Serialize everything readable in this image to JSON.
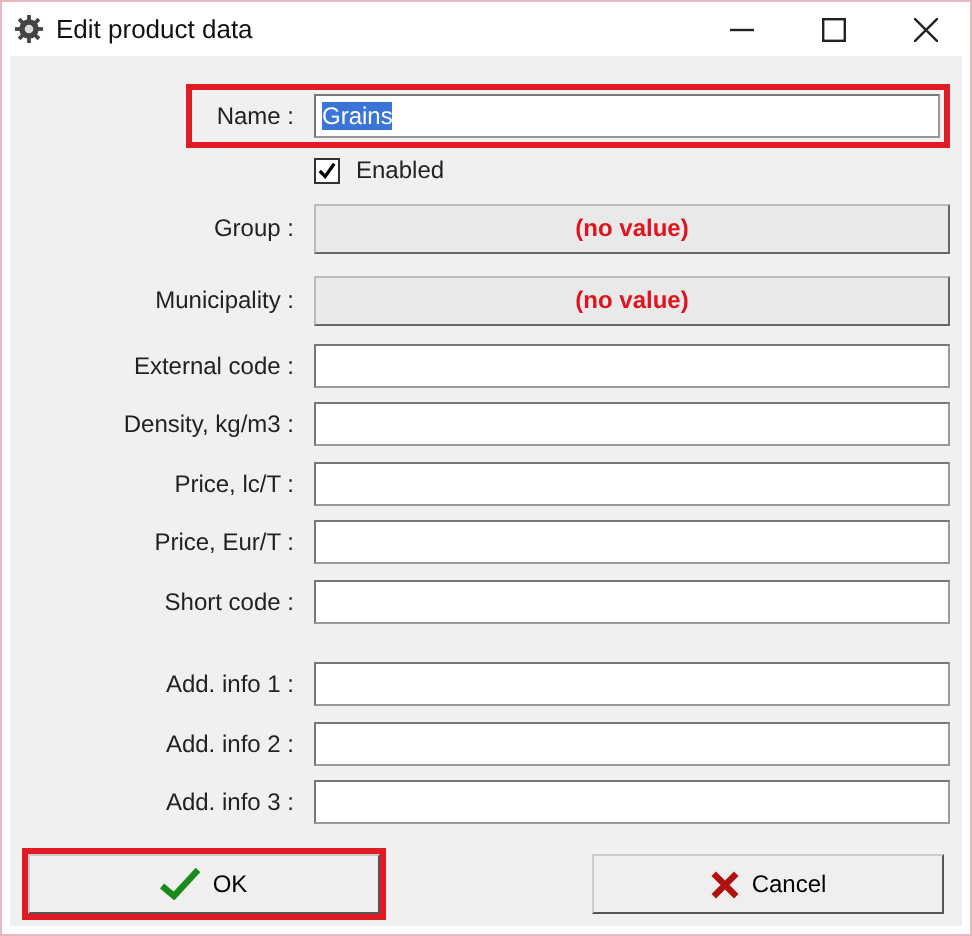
{
  "window": {
    "title": "Edit product data"
  },
  "rows": [
    {
      "kind": "text",
      "label": "Name :",
      "value": "Grains",
      "value_selected": true,
      "highlighted": true
    },
    {
      "kind": "checkbox",
      "label": "Enabled",
      "checked": true
    },
    {
      "kind": "picker",
      "label": "Group :",
      "value": "(no value)"
    },
    {
      "kind": "picker",
      "label": "Municipality :",
      "value": "(no value)"
    },
    {
      "kind": "text",
      "label": "External code :"
    },
    {
      "kind": "text",
      "label": "Density, kg/m3 :"
    },
    {
      "kind": "text",
      "label": "Price, lc/T :"
    },
    {
      "kind": "text",
      "label": "Price, Eur/T :"
    },
    {
      "kind": "text",
      "label": "Short code :"
    },
    {
      "kind": "gap"
    },
    {
      "kind": "text",
      "label": "Add. info 1 :"
    },
    {
      "kind": "text",
      "label": "Add. info 2 :"
    },
    {
      "kind": "text",
      "label": "Add. info 3 :"
    }
  ],
  "buttons": [
    {
      "kind": "ok",
      "label": "OK",
      "highlighted": true
    },
    {
      "kind": "cancel",
      "label": "Cancel",
      "highlighted": false
    }
  ]
}
